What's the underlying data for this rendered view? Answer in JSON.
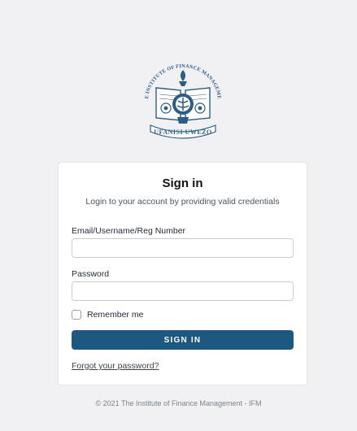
{
  "logo": {
    "ring_text": "THE INSTITUTE OF FINANCE MANAGEMENT",
    "motto": "UFANISI UWEZO",
    "icon": "ifm-emblem-icon"
  },
  "signin": {
    "title": "Sign in",
    "subtitle": "Login to your account by providing valid credentials",
    "email_label": "Email/Username/Reg Number",
    "email_value": "",
    "password_label": "Password",
    "password_value": "",
    "remember_label": "Remember me",
    "button_label": "SIGN IN",
    "forgot_label": "Forgot your password?"
  },
  "footer": {
    "text": "© 2021 The Institute of Finance Management - IFM"
  },
  "colors": {
    "primary": "#1c587f",
    "logo": "#2c5d86",
    "background": "#f1f1f3"
  }
}
